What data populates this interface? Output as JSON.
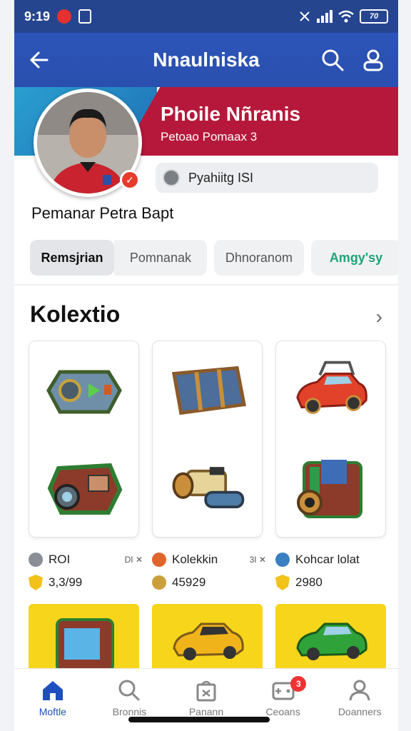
{
  "status_bar": {
    "time": "9:19",
    "battery": "70"
  },
  "app_bar": {
    "title": "Nnaulniska"
  },
  "profile": {
    "name": "Phoile Nñranis",
    "sub": "Petoao Pomaax 3",
    "rank_label": "Pyahiitg ISI",
    "caption": "Pemanar Petra Bapt"
  },
  "tabs": [
    {
      "label": "Remsjrian"
    },
    {
      "label": "Pomnanak"
    },
    {
      "label": "Dhnoranom"
    },
    {
      "label": "Amgy'sy"
    }
  ],
  "collection": {
    "title": "Kolextio",
    "items": [
      {
        "name": "ROI",
        "tag": "DI ✕",
        "price": "3,3/99"
      },
      {
        "name": "Kolekkin",
        "tag": "3I ✕",
        "price": "45929"
      },
      {
        "name": "Kohcar lolat",
        "tag": "",
        "price": "2980"
      }
    ]
  },
  "bottom_nav": [
    {
      "label": "Moftle",
      "icon": "home-icon"
    },
    {
      "label": "Bronnis",
      "icon": "search-icon"
    },
    {
      "label": "Panann",
      "icon": "gift-icon"
    },
    {
      "label": "Ceoans",
      "icon": "gamepad-icon",
      "badge": "3"
    },
    {
      "label": "Doanners",
      "icon": "profile-icon"
    }
  ],
  "colors": {
    "primary": "#2a4fae",
    "hero_red": "#b5183a",
    "accent_green": "#1fa37a",
    "card_yellow": "#f7d51b"
  }
}
